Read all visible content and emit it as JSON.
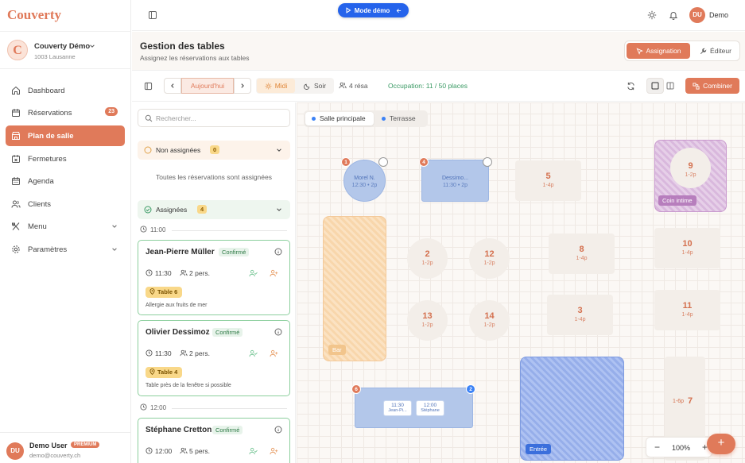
{
  "app": {
    "logo": "Couverty"
  },
  "restaurant": {
    "name": "Couverty Démo",
    "city": "1003 Lausanne"
  },
  "nav": {
    "items": [
      {
        "label": "Dashboard"
      },
      {
        "label": "Réservations",
        "badge": "23"
      },
      {
        "label": "Plan de salle"
      },
      {
        "label": "Fermetures"
      },
      {
        "label": "Agenda"
      },
      {
        "label": "Clients"
      },
      {
        "label": "Menu"
      },
      {
        "label": "Paramètres"
      }
    ]
  },
  "user": {
    "initials": "DU",
    "name": "Demo User",
    "plan": "PREMIUM",
    "email": "demo@couverty.ch"
  },
  "topbar": {
    "demo_label": "Mode démo",
    "user_initials": "DU",
    "user_name": "Demo"
  },
  "page": {
    "title": "Gestion des tables",
    "subtitle": "Assignez les réservations aux tables",
    "mode_assign": "Assignation",
    "mode_edit": "Éditeur"
  },
  "toolbar": {
    "today": "Aujourd'hui",
    "midi": "Midi",
    "soir": "Soir",
    "resa": "4 résa",
    "occupation": "Occupation: 11 / 50 places",
    "combine": "Combiner"
  },
  "panel": {
    "search_placeholder": "Rechercher...",
    "unassigned": {
      "label": "Non assignées",
      "count": "0",
      "empty": "Toutes les réservations sont assignées"
    },
    "assigned": {
      "label": "Assignées",
      "count": "4"
    },
    "time1": "11:00",
    "time2": "12:00",
    "cards": [
      {
        "name": "Jean-Pierre Müller",
        "status": "Confirmé",
        "time": "11:30",
        "pers": "2 pers.",
        "table": "Table 6",
        "note": "Allergie aux fruits de mer"
      },
      {
        "name": "Olivier Dessimoz",
        "status": "Confirmé",
        "time": "11:30",
        "pers": "2 pers.",
        "table": "Table 4",
        "note": "Table près de la fenêtre si possible"
      },
      {
        "name": "Stéphane Cretton",
        "status": "Confirmé",
        "time": "12:00",
        "pers": "5 pers."
      }
    ]
  },
  "rooms": {
    "main": "Salle principale",
    "terrace": "Terrasse"
  },
  "floor": {
    "t1": {
      "num": "Morel N.",
      "cap": "12:30 • 2p",
      "badge": "1"
    },
    "t4": {
      "num": "Dessimo...",
      "cap": "11:30 • 2p",
      "badge": "4"
    },
    "t5": {
      "num": "5",
      "cap": "1-4p"
    },
    "t9": {
      "num": "9",
      "cap": "1-2p"
    },
    "t2": {
      "num": "2",
      "cap": "1-2p"
    },
    "t12": {
      "num": "12",
      "cap": "1-2p"
    },
    "t8": {
      "num": "8",
      "cap": "1-4p"
    },
    "t10": {
      "num": "10",
      "cap": "1-4p"
    },
    "t13": {
      "num": "13",
      "cap": "1-2p"
    },
    "t14": {
      "num": "14",
      "cap": "1-2p"
    },
    "t3": {
      "num": "3",
      "cap": "1-4p"
    },
    "t11": {
      "num": "11",
      "cap": "1-4p"
    },
    "t7": {
      "num": "7",
      "cap": "1-6p"
    },
    "t6": {
      "badge": "6",
      "badge2": "2",
      "chip1_time": "11:30",
      "chip1_name": "Jean-Pi...",
      "chip2_time": "12:00",
      "chip2_name": "Stéphane"
    },
    "zones": {
      "bar": "Bar",
      "coin": "Coin intime",
      "entree": "Entrée"
    }
  },
  "zoom": {
    "level": "100%",
    "minus": "−",
    "plus": "+",
    "fab": "+"
  },
  "colors": {
    "accent": "#e07a5a",
    "blue": "#2563eb",
    "success": "#3a9a64"
  }
}
